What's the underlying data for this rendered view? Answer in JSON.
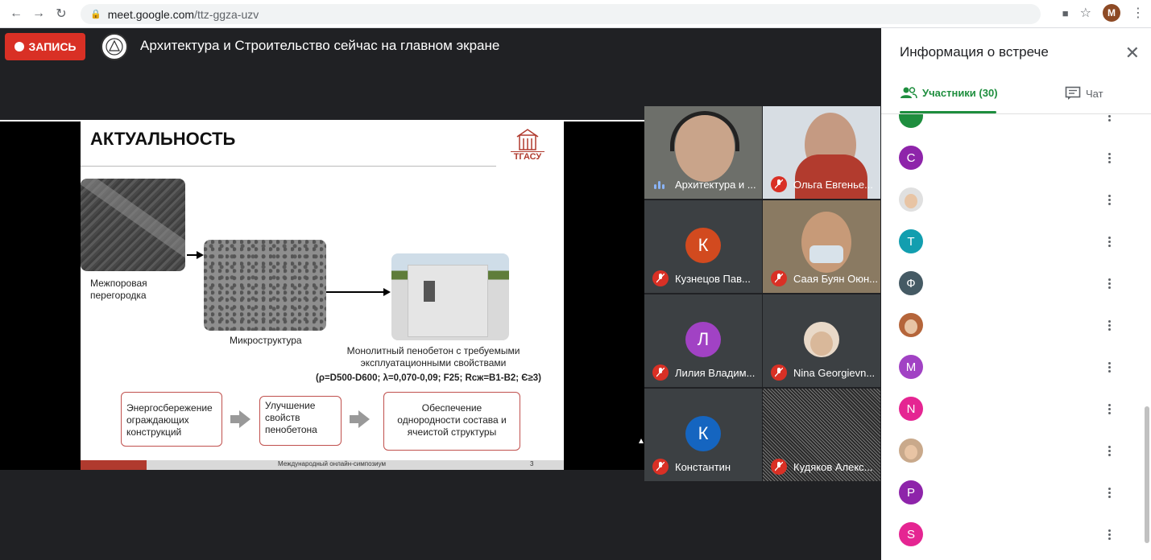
{
  "browser": {
    "url_host": "meet.google.com",
    "url_path": "/ttz-ggza-uzv",
    "profile_initial": "M"
  },
  "meet": {
    "record_label": "ЗАПИСЬ",
    "presenting_text": "Архитектура и Строительство сейчас на главном экране"
  },
  "slide": {
    "title": "АКТУАЛЬНОСТЬ",
    "logo_text": "ТГАСУ",
    "caption_partition": "Межпоровая перегородка",
    "caption_micro": "Микроструктура",
    "caption_monolith": "Монолитный пенобетон с требуемыми эксплуатационными свойствами",
    "caption_params": "(ρ=D500-D600; λ=0,070-0,09; F25; Rсж=B1-B2; Є≥3)",
    "box1": "Энергосбережение ограждающих конструкций",
    "box2": "Улучшение свойств пенобетона",
    "box3": "Обеспечение однородности состава и ячеистой структуры",
    "footer_text": "Международный онлайн-симпозиум",
    "page_number": "3"
  },
  "tiles": [
    {
      "name": "Архитектура и ...",
      "mic": "on"
    },
    {
      "name": "Ольга Евгенье...",
      "mic": "off"
    },
    {
      "name": "Кузнецов Пав...",
      "mic": "off",
      "initial": "К",
      "color": "#d24a1f"
    },
    {
      "name": "Саая Буян Оюн...",
      "mic": "off"
    },
    {
      "name": "Лилия Владим...",
      "mic": "off",
      "initial": "Л",
      "color": "#a142c4"
    },
    {
      "name": "Nina Georgievn...",
      "mic": "off"
    },
    {
      "name": "Константин",
      "mic": "off",
      "initial": "К",
      "color": "#1565c0"
    },
    {
      "name": "Кудяков Алекс...",
      "mic": "off"
    }
  ],
  "panel": {
    "title": "Информация о встрече",
    "tab_people": "Участники (30)",
    "tab_chat": "Чат",
    "participants": [
      {
        "initial": "С",
        "color": "#8e24aa"
      },
      {
        "initial": "",
        "color": "#e0e0e0",
        "photo": true
      },
      {
        "initial": "T",
        "color": "#129eaf"
      },
      {
        "initial": "Ф",
        "color": "#455a64"
      },
      {
        "initial": "",
        "color": "#b5653a",
        "photo": true
      },
      {
        "initial": "M",
        "color": "#a142c4"
      },
      {
        "initial": "N",
        "color": "#e52592"
      },
      {
        "initial": "",
        "color": "#c9a98b",
        "photo": true
      },
      {
        "initial": "P",
        "color": "#8e24aa"
      },
      {
        "initial": "S",
        "color": "#e52592"
      }
    ]
  }
}
